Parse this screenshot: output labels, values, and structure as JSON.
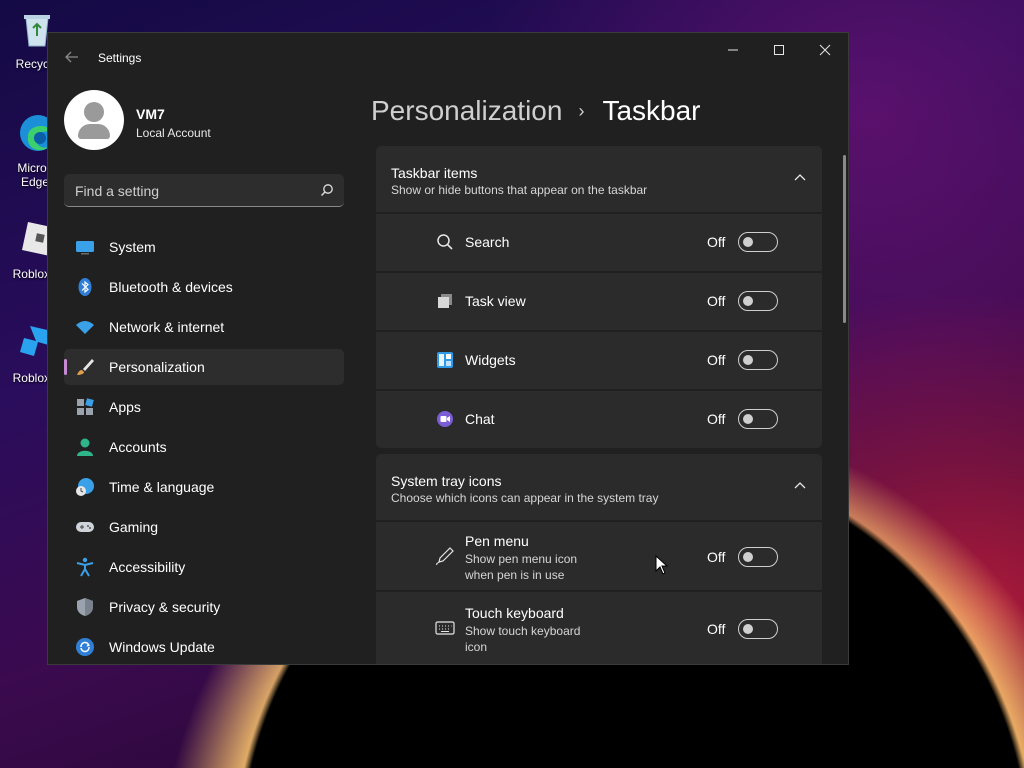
{
  "desktop": {
    "icons": [
      {
        "name": "recycle-bin",
        "label": "Recycle"
      },
      {
        "name": "microsoft-edge",
        "label": "Micros",
        "label2": "Edge"
      },
      {
        "name": "roblox-player",
        "label": "Roblox P"
      },
      {
        "name": "roblox-studio",
        "label": "Roblox S"
      }
    ]
  },
  "window": {
    "title": "Settings"
  },
  "profile": {
    "name": "VM7",
    "account_type": "Local Account"
  },
  "search": {
    "placeholder": "Find a setting"
  },
  "nav": {
    "items": [
      {
        "label": "System",
        "icon": "monitor-icon"
      },
      {
        "label": "Bluetooth & devices",
        "icon": "bluetooth-icon"
      },
      {
        "label": "Network & internet",
        "icon": "wifi-icon"
      },
      {
        "label": "Personalization",
        "icon": "brush-icon",
        "selected": true
      },
      {
        "label": "Apps",
        "icon": "apps-icon"
      },
      {
        "label": "Accounts",
        "icon": "person-icon"
      },
      {
        "label": "Time & language",
        "icon": "globe-clock-icon"
      },
      {
        "label": "Gaming",
        "icon": "gamepad-icon"
      },
      {
        "label": "Accessibility",
        "icon": "accessibility-icon"
      },
      {
        "label": "Privacy & security",
        "icon": "shield-icon"
      },
      {
        "label": "Windows Update",
        "icon": "update-icon"
      }
    ]
  },
  "breadcrumb": {
    "parent": "Personalization",
    "separator": "›",
    "current": "Taskbar"
  },
  "taskbar_items": {
    "title": "Taskbar items",
    "description": "Show or hide buttons that appear on the taskbar",
    "rows": [
      {
        "label": "Search",
        "state": "Off",
        "icon": "search-icon"
      },
      {
        "label": "Task view",
        "state": "Off",
        "icon": "task-view-icon"
      },
      {
        "label": "Widgets",
        "state": "Off",
        "icon": "widgets-icon"
      },
      {
        "label": "Chat",
        "state": "Off",
        "icon": "chat-icon"
      }
    ]
  },
  "system_tray": {
    "title": "System tray icons",
    "description": "Choose which icons can appear in the system tray",
    "rows": [
      {
        "label": "Pen menu",
        "sub1": "Show pen menu icon",
        "sub2": "when pen is in use",
        "state": "Off",
        "icon": "pen-icon"
      },
      {
        "label": "Touch keyboard",
        "sub1": "Show touch keyboard",
        "sub2": "icon",
        "state": "Off",
        "icon": "keyboard-icon"
      }
    ]
  },
  "colors": {
    "accent": "#c78bd4",
    "window_bg": "#202020",
    "card_bg": "#2b2b2b"
  }
}
